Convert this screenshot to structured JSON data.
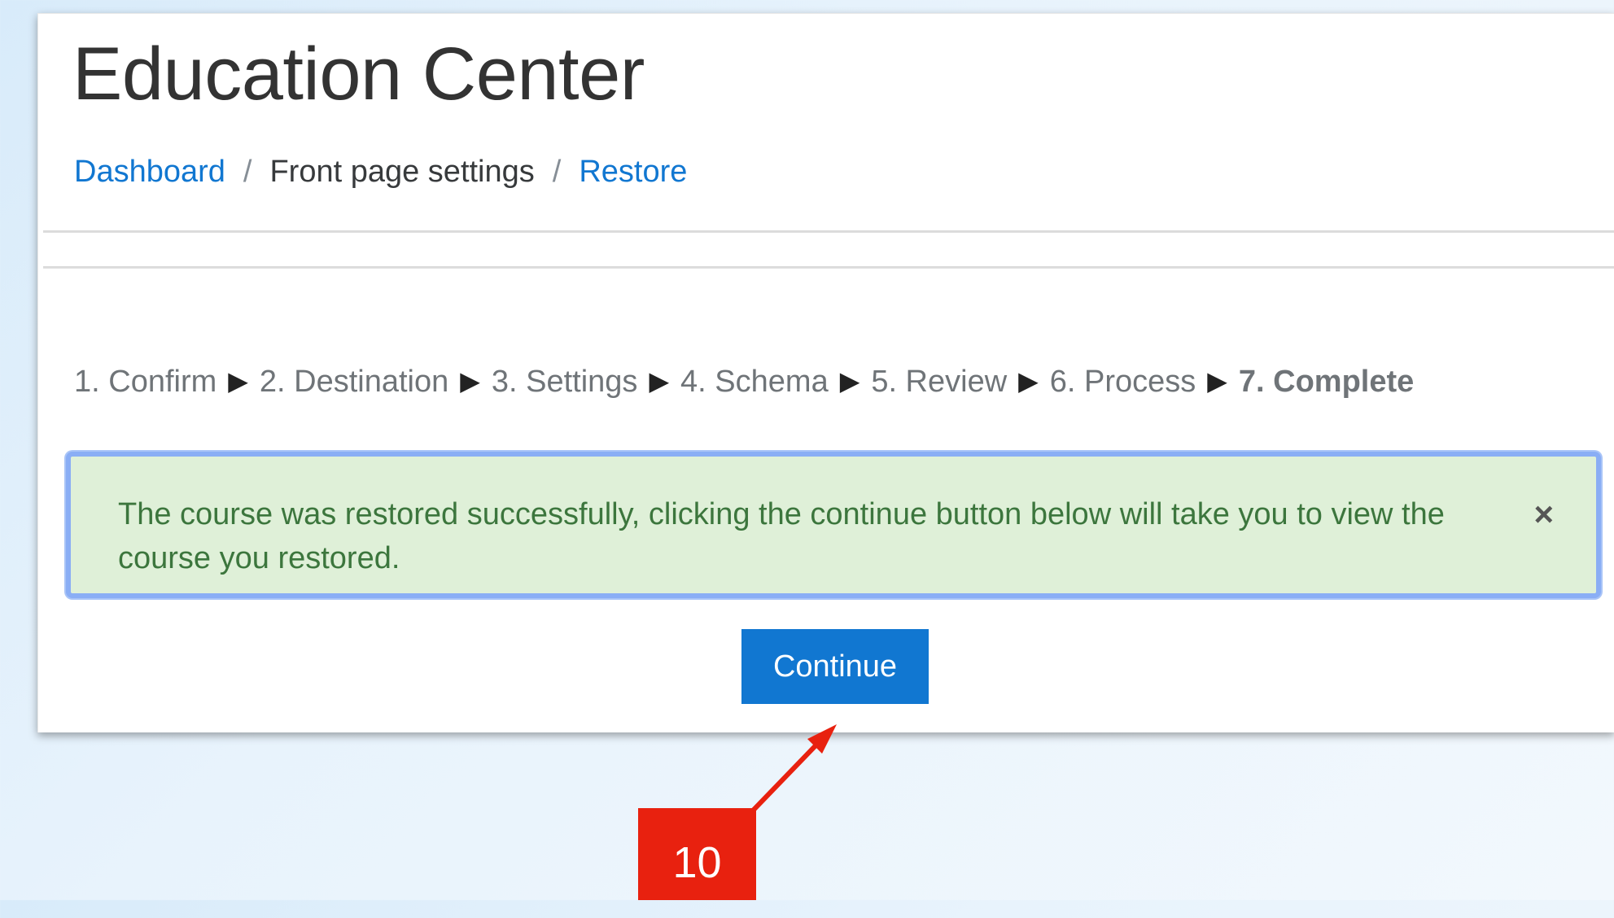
{
  "header": {
    "title": "Education Center"
  },
  "breadcrumb": {
    "items": [
      {
        "label": "Dashboard"
      },
      {
        "label": "Front page settings"
      },
      {
        "label": "Restore"
      }
    ],
    "separator": "/"
  },
  "steps": {
    "items": [
      {
        "label": "1. Confirm"
      },
      {
        "label": "2. Destination"
      },
      {
        "label": "3. Settings"
      },
      {
        "label": "4. Schema"
      },
      {
        "label": "5. Review"
      },
      {
        "label": "6. Process"
      },
      {
        "label": "7. Complete"
      }
    ],
    "current": "7. Complete"
  },
  "alert": {
    "message": "The course was restored successfully, clicking the continue button below will take you to view the course you restored.",
    "close_label": "×"
  },
  "actions": {
    "continue_label": "Continue"
  },
  "annotation": {
    "step_number": "10"
  },
  "colors": {
    "link": "#1177d1",
    "alert_bg": "#dff0d8",
    "alert_text": "#3c763d",
    "alert_focus_border": "#8aaef5",
    "button_bg": "#1177d1",
    "annotation_red": "#e8210f"
  },
  "icons": {
    "step_separator": "triangle-right-icon",
    "alert_close": "close-icon"
  }
}
